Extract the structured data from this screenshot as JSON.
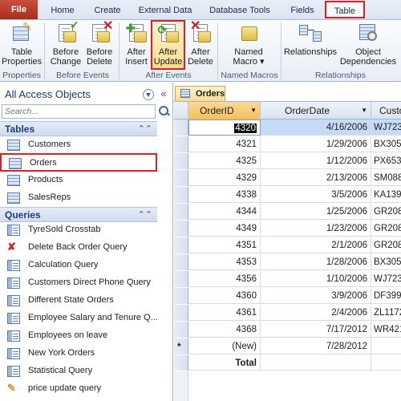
{
  "tabs": [
    {
      "label": "File"
    },
    {
      "label": "Home"
    },
    {
      "label": "Create"
    },
    {
      "label": "External Data"
    },
    {
      "label": "Database Tools"
    },
    {
      "label": "Fields"
    },
    {
      "label": "Table"
    }
  ],
  "ribbon": {
    "buttons": [
      {
        "line1": "Table",
        "line2": "Properties"
      },
      {
        "line1": "Before",
        "line2": "Change"
      },
      {
        "line1": "Before",
        "line2": "Delete"
      },
      {
        "line1": "After",
        "line2": "Insert"
      },
      {
        "line1": "After",
        "line2": "Update"
      },
      {
        "line1": "After",
        "line2": "Delete"
      },
      {
        "line1": "Named",
        "line2": "Macro ▾"
      },
      {
        "line1": "Relationships",
        "line2": ""
      },
      {
        "line1": "Object",
        "line2": "Dependencies"
      }
    ],
    "groups": [
      {
        "label": "Properties"
      },
      {
        "label": "Before Events"
      },
      {
        "label": "After Events"
      },
      {
        "label": "Named Macros"
      },
      {
        "label": "Relationships"
      }
    ]
  },
  "nav": {
    "title": "All Access Objects",
    "search_placeholder": "Search...",
    "tables_header": "Tables",
    "queries_header": "Queries",
    "tables": [
      {
        "label": "Customers"
      },
      {
        "label": "Orders"
      },
      {
        "label": "Products"
      },
      {
        "label": "SalesReps"
      }
    ],
    "queries": [
      {
        "label": "TyreSold Crosstab"
      },
      {
        "label": "Delete Back Order Query"
      },
      {
        "label": "Calculation Query"
      },
      {
        "label": "Customers Direct Phone Query"
      },
      {
        "label": "Different State Orders"
      },
      {
        "label": "Employee Salary and Tenure Q..."
      },
      {
        "label": "Employees on leave"
      },
      {
        "label": "New York Orders"
      },
      {
        "label": "Statistical Query"
      },
      {
        "label": "price update query"
      }
    ]
  },
  "document": {
    "tab_label": "Orders",
    "columns": [
      "OrderID",
      "OrderDate",
      "Custo"
    ],
    "rows": [
      {
        "id": "4320",
        "date": "4/16/2006",
        "cust": "WJ723"
      },
      {
        "id": "4321",
        "date": "1/29/2006",
        "cust": "BX305"
      },
      {
        "id": "4325",
        "date": "1/12/2006",
        "cust": "PX653"
      },
      {
        "id": "4329",
        "date": "2/13/2006",
        "cust": "SM088"
      },
      {
        "id": "4338",
        "date": "3/5/2006",
        "cust": "KA139"
      },
      {
        "id": "4344",
        "date": "1/25/2006",
        "cust": "GR208"
      },
      {
        "id": "4349",
        "date": "1/23/2006",
        "cust": "GR208"
      },
      {
        "id": "4351",
        "date": "2/1/2006",
        "cust": "GR208"
      },
      {
        "id": "4353",
        "date": "1/28/2006",
        "cust": "BX305"
      },
      {
        "id": "4356",
        "date": "1/10/2006",
        "cust": "WJ723"
      },
      {
        "id": "4360",
        "date": "3/9/2006",
        "cust": "DF399"
      },
      {
        "id": "4361",
        "date": "2/4/2006",
        "cust": "ZL1172"
      },
      {
        "id": "4368",
        "date": "7/17/2012",
        "cust": "WR421"
      }
    ],
    "new_row": {
      "marker": "*",
      "id": "(New)",
      "date": "7/28/2012"
    },
    "total_label": "Total"
  }
}
